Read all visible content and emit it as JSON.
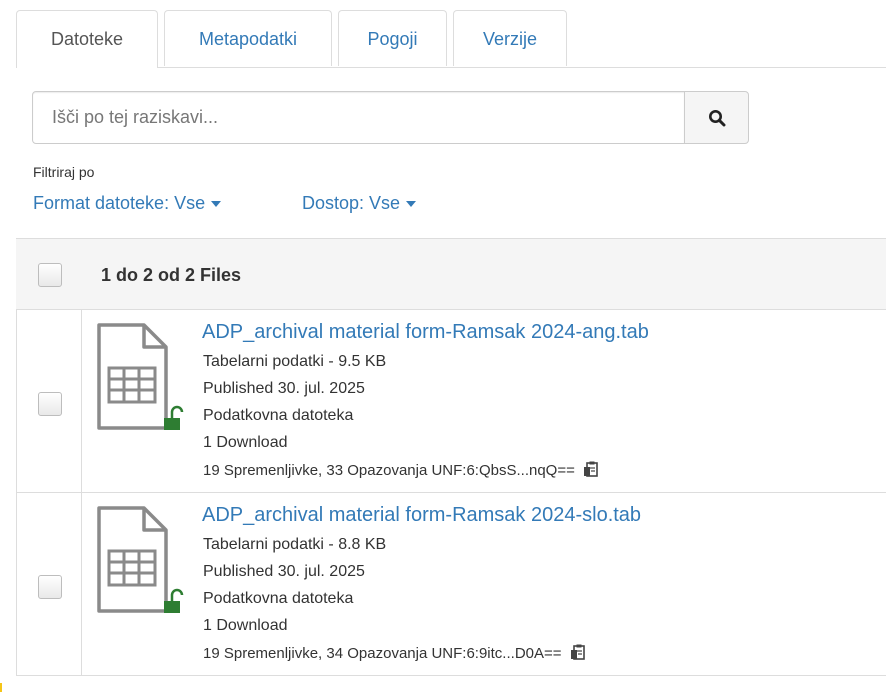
{
  "tabs": [
    {
      "label": "Datoteke",
      "active": true
    },
    {
      "label": "Metapodatki",
      "active": false
    },
    {
      "label": "Pogoji",
      "active": false
    },
    {
      "label": "Verzije",
      "active": false
    }
  ],
  "search": {
    "placeholder": "Išči po tej raziskavi...",
    "value": "",
    "button_icon": "search-icon"
  },
  "filters": {
    "label": "Filtriraj po",
    "format": "Format datoteke: Vse",
    "access": "Dostop: Vse"
  },
  "table": {
    "header": "1 do 2 od 2 Files",
    "files": [
      {
        "name": "ADP_archival material form-Ramsak 2024-ang.tab",
        "type_size": "Tabelarni podatki - 9.5 KB",
        "published": "Published 30. jul. 2025",
        "category": "Podatkovna datoteka",
        "downloads": "1 Download",
        "summary": "19 Spremenljivke, 33 Opazovanja UNF:6:QbsS...nqQ=="
      },
      {
        "name": "ADP_archival material form-Ramsak 2024-slo.tab",
        "type_size": "Tabelarni podatki - 8.8 KB",
        "published": "Published 30. jul. 2025",
        "category": "Podatkovna datoteka",
        "downloads": "1 Download",
        "summary": "19 Spremenljivke, 34 Opazovanja UNF:6:9itc...D0A=="
      }
    ]
  },
  "colors": {
    "link": "#337ab7",
    "text": "#333333",
    "border": "#dddddd",
    "header_bg": "#f5f5f5",
    "lock": "#2e7d32"
  }
}
